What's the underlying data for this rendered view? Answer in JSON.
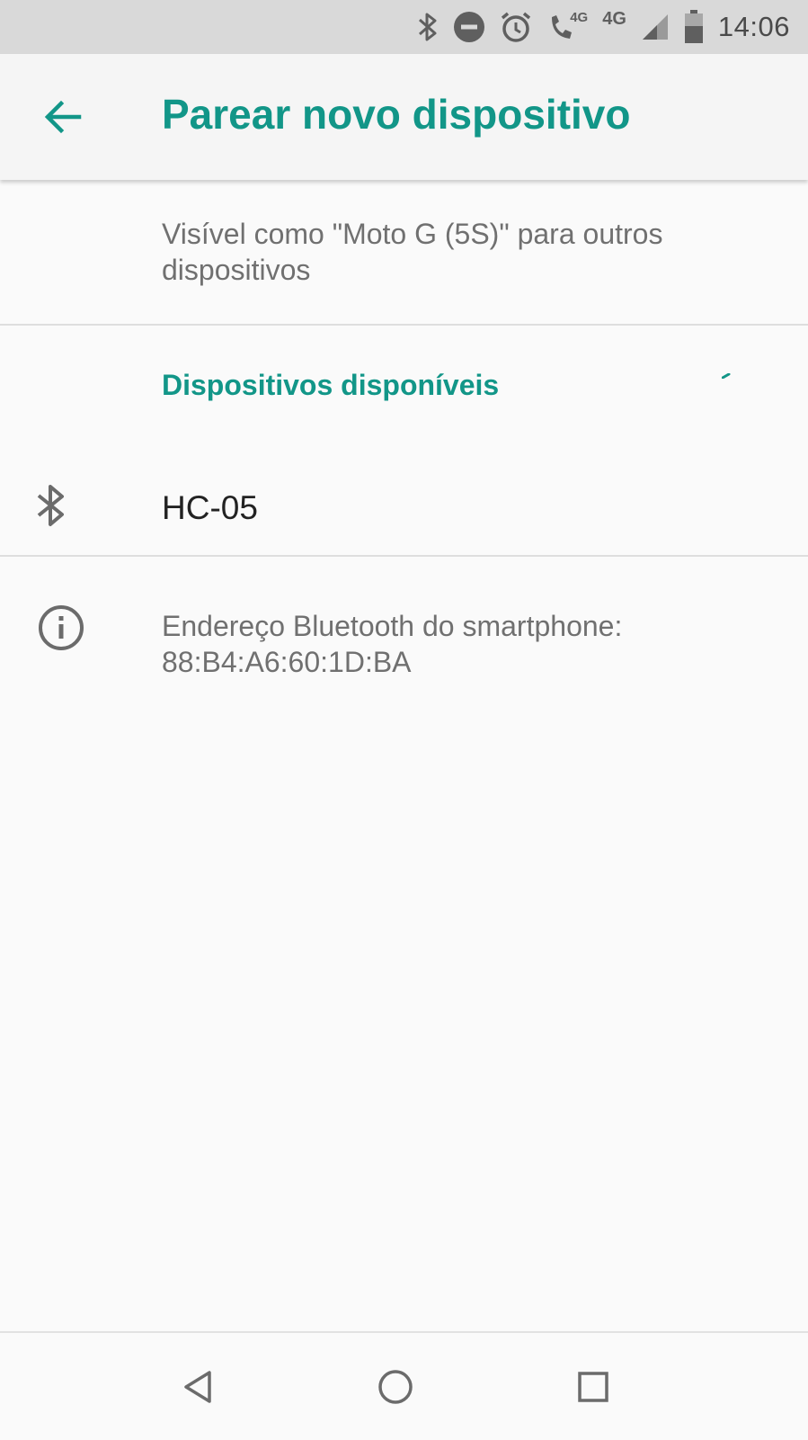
{
  "status_bar": {
    "time": "14:06",
    "network_label": "4G",
    "call_network_label": "4G",
    "icons": [
      "bluetooth-icon",
      "do-not-disturb-icon",
      "alarm-icon",
      "wifi-calling-icon",
      "signal-icon",
      "battery-icon"
    ]
  },
  "app_bar": {
    "title": "Parear novo dispositivo",
    "back_icon": "arrow-back-icon"
  },
  "visibility": {
    "text": "Visível como \"Moto G (5S)\" para outros dispositivos"
  },
  "available": {
    "header": "Dispositivos disponíveis",
    "devices": [
      {
        "name": "HC-05",
        "icon": "bluetooth-icon"
      }
    ]
  },
  "info": {
    "icon": "info-icon",
    "text": "Endereço Bluetooth do smartphone: 88:B4:A6:60:1D:BA"
  },
  "nav_bar": {
    "buttons": [
      "back-triangle-icon",
      "home-circle-icon",
      "recents-square-icon"
    ]
  },
  "colors": {
    "accent": "#129688",
    "status_bar_bg": "#d9d9d9",
    "background": "#fafafa"
  }
}
